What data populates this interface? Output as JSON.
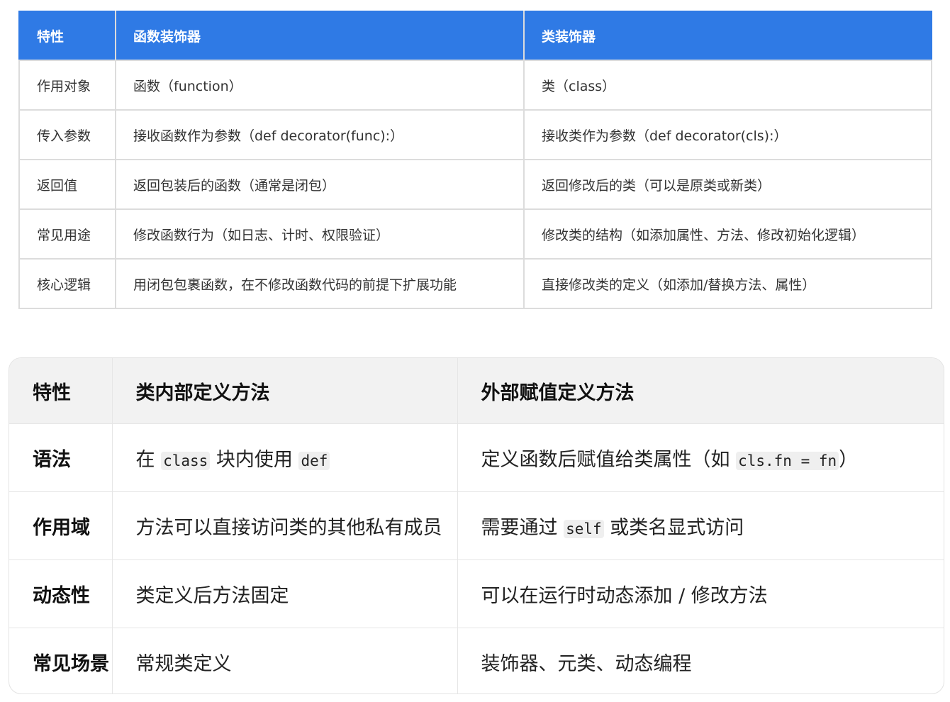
{
  "table1": {
    "header": [
      "特性",
      "函数装饰器",
      "类装饰器"
    ],
    "rows": [
      [
        "作用对象",
        "函数（function）",
        "类（class）"
      ],
      [
        "传入参数",
        "接收函数作为参数（def decorator(func):）",
        "接收类作为参数（def decorator(cls):）"
      ],
      [
        "返回值",
        "返回包装后的函数（通常是闭包）",
        "返回修改后的类（可以是原类或新类）"
      ],
      [
        "常见用途",
        "修改函数行为（如日志、计时、权限验证）",
        "修改类的结构（如添加属性、方法、修改初始化逻辑）"
      ],
      [
        "核心逻辑",
        "用闭包包裹函数，在不修改函数代码的前提下扩展功能",
        "直接修改类的定义（如添加/替换方法、属性）"
      ]
    ],
    "header_color": "#2f7ae5"
  },
  "table2": {
    "header": [
      "特性",
      "类内部定义方法",
      "外部赋值定义方法"
    ],
    "rows": [
      {
        "label": "语法",
        "internal": {
          "pre": "在 ",
          "code1": "class",
          "mid": " 块内使用 ",
          "code2": "def"
        },
        "external": {
          "pre": "定义函数后赋值给类属性（如 ",
          "code": "cls.fn = fn",
          "post": "）"
        }
      },
      {
        "label": "作用域",
        "internal": "方法可以直接访问类的其他私有成员",
        "external": {
          "pre": "需要通过 ",
          "code": "self",
          "post": " 或类名显式访问"
        }
      },
      {
        "label": "动态性",
        "internal": "类定义后方法固定",
        "external": "可以在运行时动态添加 / 修改方法"
      },
      {
        "label": "常见场景",
        "internal": "常规类定义",
        "external": "装饰器、元类、动态编程"
      }
    ],
    "header_bg": "#f2f2f2"
  }
}
